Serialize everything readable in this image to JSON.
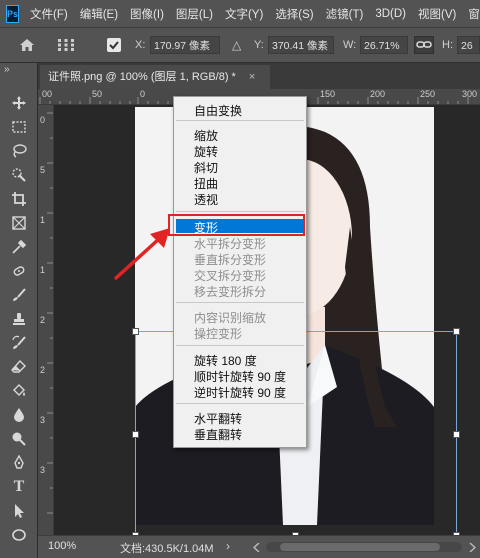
{
  "app": {
    "logo": "Ps"
  },
  "menubar": [
    "文件(F)",
    "编辑(E)",
    "图像(I)",
    "图层(L)",
    "文字(Y)",
    "选择(S)",
    "滤镜(T)",
    "3D(D)",
    "视图(V)",
    "窗口"
  ],
  "options": {
    "x_label": "X:",
    "x_value": "170.97 像素",
    "delta_icon": "△",
    "y_label": "Y:",
    "y_value": "370.41 像素",
    "w_label": "W:",
    "w_value": "26.71%",
    "h_label": "H:",
    "h_value": "26"
  },
  "document": {
    "tab_title": "证件照.png @ 100% (图层 1, RGB/8) *",
    "tab_close": "×",
    "toolbar_collapse": "»"
  },
  "ruler": {
    "h_ticks": [
      "00",
      "50",
      "0",
      "50",
      "100",
      "150",
      "200",
      "250",
      "300"
    ],
    "v_ticks": [
      "0",
      "5",
      "1",
      "1",
      "2",
      "2",
      "3",
      "3"
    ]
  },
  "status": {
    "zoom": "100%",
    "doc_info": "文档:430.5K/1.04M",
    "arrow": "›"
  },
  "context_menu": {
    "items": [
      {
        "label": "自由变换",
        "disabled": false
      },
      {
        "label": "缩放",
        "disabled": false
      },
      {
        "label": "旋转",
        "disabled": false
      },
      {
        "label": "斜切",
        "disabled": false
      },
      {
        "label": "扭曲",
        "disabled": false
      },
      {
        "label": "透视",
        "disabled": false
      },
      {
        "label": "变形",
        "disabled": false,
        "highlighted": true
      },
      {
        "label": "水平拆分变形",
        "disabled": true
      },
      {
        "label": "垂直拆分变形",
        "disabled": true
      },
      {
        "label": "交叉拆分变形",
        "disabled": true
      },
      {
        "label": "移去变形拆分",
        "disabled": true
      },
      {
        "label": "内容识别缩放",
        "disabled": true
      },
      {
        "label": "操控变形",
        "disabled": true
      },
      {
        "label": "旋转 180 度",
        "disabled": false
      },
      {
        "label": "顺时针旋转 90 度",
        "disabled": false
      },
      {
        "label": "逆时针旋转 90 度",
        "disabled": false
      },
      {
        "label": "水平翻转",
        "disabled": false
      },
      {
        "label": "垂直翻转",
        "disabled": false
      }
    ]
  },
  "colors": {
    "highlight": "#0078d7",
    "annotation_red": "#e02424",
    "panel": "#535353",
    "canvas": "#282828"
  },
  "icons": [
    "home-icon",
    "transform-anchor-icon",
    "checkbox-icon",
    "link-icon",
    "move-tool-icon",
    "marquee-tool-icon",
    "lasso-tool-icon",
    "quick-select-tool-icon",
    "crop-tool-icon",
    "frame-tool-icon",
    "eyedropper-tool-icon",
    "healing-brush-icon",
    "brush-tool-icon",
    "stamp-tool-icon",
    "history-brush-icon",
    "eraser-tool-icon",
    "paint-bucket-icon",
    "blur-tool-icon",
    "dodge-tool-icon",
    "pen-tool-icon",
    "type-tool-icon",
    "path-select-icon",
    "ellipse-tool-icon"
  ]
}
